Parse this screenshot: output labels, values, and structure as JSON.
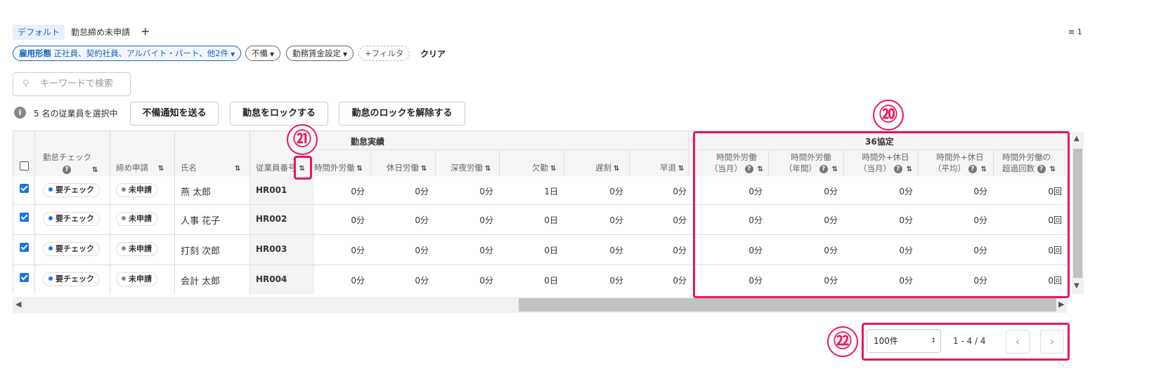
{
  "tabs": [
    {
      "label": "デフォルト"
    },
    {
      "label": "勤怠締め未申請"
    }
  ],
  "add_tab_symbol": "+",
  "filter_count": "1",
  "filters": {
    "employment": {
      "label": "雇用形態",
      "value": "正社員、契約社員、アルバイト・パート、他2件"
    },
    "defect": "不備",
    "wage": "勤務賃金設定",
    "add_filter": "+フィルタ",
    "clear": "クリア"
  },
  "search": {
    "placeholder": "キーワードで検索"
  },
  "selection": {
    "info": "5 名の従業員を選択中"
  },
  "actions": {
    "send_notice": "不備通知を送る",
    "lock": "勤怠をロックする",
    "unlock": "勤怠のロックを解除する"
  },
  "table": {
    "group_headers": {
      "attendance": "勤怠実績",
      "agreement36": "36協定"
    },
    "columns": {
      "check": "勤怠チェック",
      "apply": "締め申請",
      "name": "氏名",
      "emp_no": "従業員番号",
      "overtime": "時間外労働",
      "holiday": "休日労働",
      "night": "深夜労働",
      "absence": "欠勤",
      "late": "遅刻",
      "early": "早退",
      "a36_1": [
        "時間外労働",
        "（当月）"
      ],
      "a36_2": [
        "時間外労働",
        "（年間）"
      ],
      "a36_3": [
        "時間外+休日",
        "（当月）"
      ],
      "a36_4": [
        "時間外+休日",
        "（平均）"
      ],
      "a36_5": [
        "時間外労働の",
        "超過回数"
      ]
    },
    "rows": [
      {
        "check": "要チェック",
        "apply": "未申請",
        "name": "燕 太郎",
        "emp_no": "HR001",
        "vals": [
          "0分",
          "0分",
          "0分",
          "1日",
          "0分",
          "0分",
          "0分",
          "0分",
          "0分",
          "0分",
          "0回"
        ]
      },
      {
        "check": "要チェック",
        "apply": "未申請",
        "name": "人事 花子",
        "emp_no": "HR002",
        "vals": [
          "0分",
          "0分",
          "0分",
          "0日",
          "0分",
          "0分",
          "0分",
          "0分",
          "0分",
          "0分",
          "0回"
        ]
      },
      {
        "check": "要チェック",
        "apply": "未申請",
        "name": "打刻 次郎",
        "emp_no": "HR003",
        "vals": [
          "0分",
          "0分",
          "0分",
          "0日",
          "0分",
          "0分",
          "0分",
          "0分",
          "0分",
          "0分",
          "0回"
        ]
      },
      {
        "check": "要チェック",
        "apply": "未申請",
        "name": "会計 太郎",
        "emp_no": "HR004",
        "vals": [
          "0分",
          "0分",
          "0分",
          "0日",
          "0分",
          "0分",
          "0分",
          "0分",
          "0分",
          "0分",
          "0回"
        ]
      }
    ]
  },
  "pagination": {
    "per_page": "100件",
    "range": "1 - 4 / 4"
  },
  "annotations": {
    "n20": "⑳",
    "n21": "㉑",
    "n22": "㉒"
  },
  "colors": {
    "accent": "#1a73e8",
    "annotation": "#e8175d",
    "check_dot": "#1a73e8",
    "apply_dot": "#888888"
  }
}
